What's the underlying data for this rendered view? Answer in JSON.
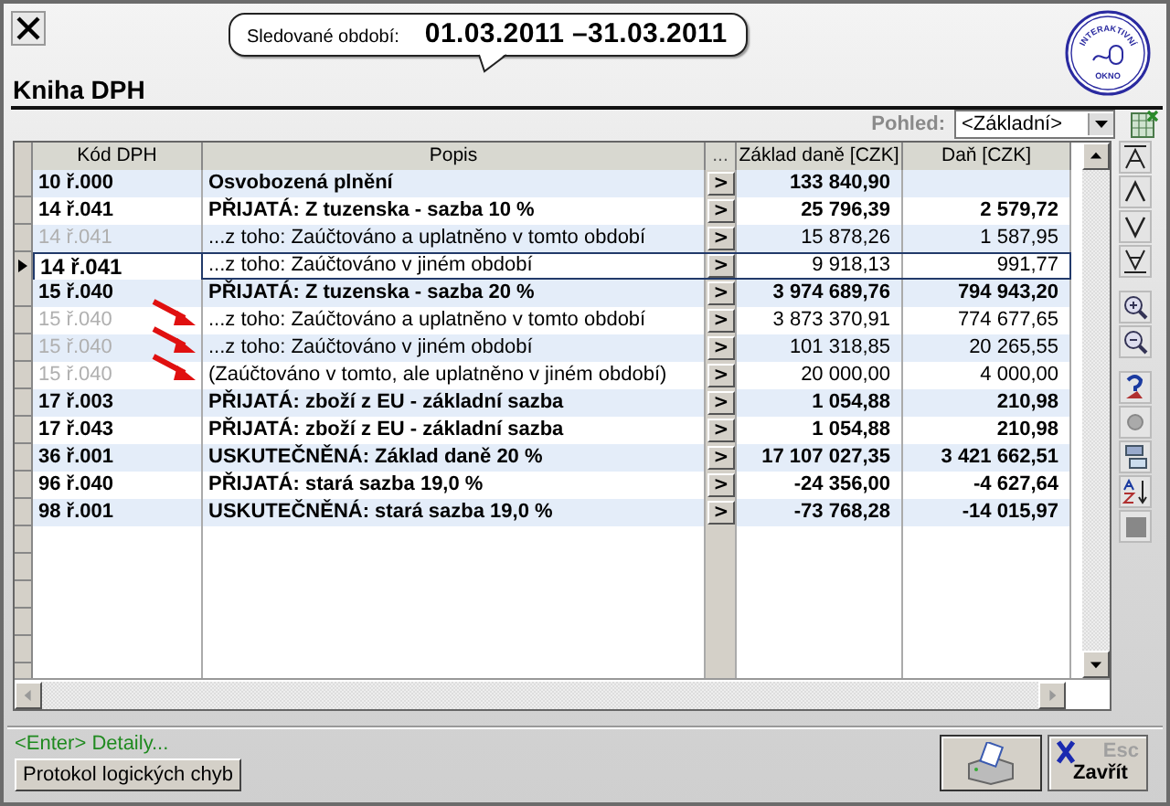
{
  "period": {
    "label": "Sledované období:",
    "value": "01.03.2011 –31.03.2011"
  },
  "logo": {
    "top": "INTERAKTIVNÍ",
    "bottom": "OKNO"
  },
  "title": "Kniha DPH",
  "view": {
    "label": "Pohled:",
    "value": "<Základní>"
  },
  "table": {
    "columns": [
      "Kód DPH",
      "Popis",
      "...",
      "Základ daně [CZK]",
      "Daň [CZK]"
    ],
    "rows": [
      {
        "kind": "main",
        "code": "10 ř.000",
        "description": "Osvobozená plnění",
        "button": ">",
        "base": "133 840,90",
        "current": false,
        "arrow": false
      },
      {
        "kind": "main",
        "code": "14 ř.041",
        "description": "PŘIJATÁ: Z tuzenska - sazba 10 %",
        "button": ">",
        "base": "25 796,39",
        "tax": "2 579,72",
        "current": false,
        "arrow": false
      },
      {
        "kind": "sub",
        "code": "14 ř.041",
        "description": "...z toho: Zaúčtováno a uplatněno v tomto období",
        "button": ">",
        "base": "15 878,26",
        "tax": "1 587,95",
        "current": false,
        "arrow": false
      },
      {
        "kind": "sub",
        "code": "14 ř.041",
        "description": "...z toho: Zaúčtováno v jiném období",
        "button": ">",
        "base": "9 918,13",
        "tax": "991,77",
        "current": true,
        "arrow": false
      },
      {
        "kind": "main",
        "code": "15 ř.040",
        "description": "PŘIJATÁ: Z tuzenska - sazba 20 %",
        "button": ">",
        "base": "3 974 689,76",
        "tax": "794 943,20",
        "current": false,
        "arrow": false
      },
      {
        "kind": "sub",
        "code": "15 ř.040",
        "description": "...z toho: Zaúčtováno a uplatněno v tomto období",
        "button": ">",
        "base": "3 873 370,91",
        "tax": "774 677,65",
        "current": false,
        "arrow": true
      },
      {
        "kind": "sub",
        "code": "15 ř.040",
        "description": "...z toho: Zaúčtováno v jiném období",
        "button": ">",
        "base": "101 318,85",
        "tax": "20 265,55",
        "current": false,
        "arrow": true
      },
      {
        "kind": "sub",
        "code": "15 ř.040",
        "description": "(Zaúčtováno v tomto, ale uplatněno v jiném období)",
        "button": ">",
        "base": "20 000,00",
        "tax": "4 000,00",
        "current": false,
        "arrow": true
      },
      {
        "kind": "main",
        "code": "17 ř.003",
        "description": "PŘIJATÁ: zboží z EU - základní sazba",
        "button": ">",
        "base": "1 054,88",
        "tax": "210,98",
        "current": false,
        "arrow": false
      },
      {
        "kind": "main",
        "code": "17 ř.043",
        "description": "PŘIJATÁ: zboží z EU - základní sazba",
        "button": ">",
        "base": "1 054,88",
        "tax": "210,98",
        "current": false,
        "arrow": false
      },
      {
        "kind": "main",
        "code": "36 ř.001",
        "description": "USKUTEČNĚNÁ: Základ daně 20 %",
        "button": ">",
        "base": "17 107 027,35",
        "tax": "3 421 662,51",
        "current": false,
        "arrow": false
      },
      {
        "kind": "main",
        "code": "96 ř.040",
        "description": "PŘIJATÁ: stará sazba 19,0 %",
        "button": ">",
        "base": "-24 356,00",
        "tax": "-4 627,64",
        "current": false,
        "arrow": false
      },
      {
        "kind": "main",
        "code": "98 ř.001",
        "description": "USKUTEČNĚNÁ: stará sazba 19,0 %",
        "button": ">",
        "base": "-73 768,28",
        "tax": "-14 015,97",
        "current": false,
        "arrow": false
      }
    ]
  },
  "hint": "<Enter> Detaily...",
  "protocol_button": "Protokol logických chyb",
  "close_button": {
    "key": "Esc",
    "label": "Zavřít"
  }
}
